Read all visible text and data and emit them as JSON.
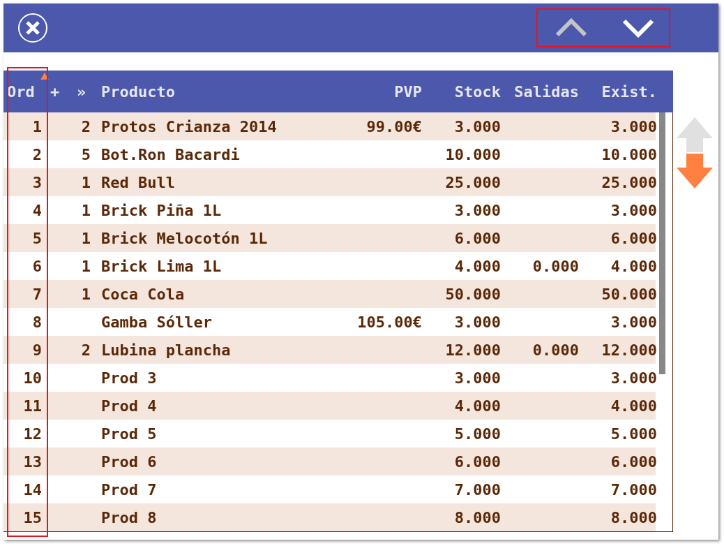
{
  "toolbar": {
    "nav_buttons": [
      {
        "kind": "up",
        "disabled": true
      },
      {
        "kind": "down",
        "disabled": false
      }
    ]
  },
  "table": {
    "columns": [
      {
        "label": "Ord",
        "sorted": true
      },
      {
        "label": "+",
        "sorted": false
      },
      {
        "label": "»",
        "sorted": false
      },
      {
        "label": "Producto",
        "sorted": false
      },
      {
        "label": "PVP",
        "sorted": false
      },
      {
        "label": "Stock",
        "sorted": false
      },
      {
        "label": "Salidas",
        "sorted": false
      },
      {
        "label": "Exist.",
        "sorted": false
      }
    ],
    "rows": [
      {
        "ord": "1",
        "qty": "2",
        "product": "Protos Crianza 2014",
        "pvp": "99.00€",
        "stock": "3.000",
        "exist": "3.000"
      },
      {
        "ord": "2",
        "qty": "5",
        "product": "Bot.Ron Bacardi",
        "stock": "10.000",
        "exist": "10.000"
      },
      {
        "ord": "3",
        "qty": "1",
        "product": "Red Bull",
        "stock": "25.000",
        "exist": "25.000"
      },
      {
        "ord": "4",
        "qty": "1",
        "product": "Brick Piña 1L",
        "stock": "3.000",
        "exist": "3.000"
      },
      {
        "ord": "5",
        "qty": "1",
        "product": "Brick Melocotón 1L",
        "stock": "6.000",
        "exist": "6.000"
      },
      {
        "ord": "6",
        "qty": "1",
        "product": "Brick Lima 1L",
        "stock": "4.000",
        "salidas": "0.000",
        "exist": "4.000"
      },
      {
        "ord": "7",
        "qty": "1",
        "product": "Coca Cola",
        "stock": "50.000",
        "exist": "50.000"
      },
      {
        "ord": "8",
        "product": "Gamba Sóller",
        "pvp": "105.00€",
        "stock": "3.000",
        "exist": "3.000"
      },
      {
        "ord": "9",
        "qty": "2",
        "product": "Lubina plancha",
        "stock": "12.000",
        "salidas": "0.000",
        "exist": "12.000"
      },
      {
        "ord": "10",
        "product": "Prod 3",
        "stock": "3.000",
        "exist": "3.000"
      },
      {
        "ord": "11",
        "product": "Prod 4",
        "stock": "4.000",
        "exist": "4.000"
      },
      {
        "ord": "12",
        "product": "Prod 5",
        "stock": "5.000",
        "exist": "5.000"
      },
      {
        "ord": "13",
        "product": "Prod 6",
        "stock": "6.000",
        "exist": "6.000"
      },
      {
        "ord": "14",
        "product": "Prod 7",
        "stock": "7.000",
        "exist": "7.000"
      },
      {
        "ord": "15",
        "product": "Prod 8",
        "stock": "8.000",
        "exist": "8.000"
      }
    ]
  },
  "scroll_buttons": [
    {
      "kind": "up",
      "disabled": true
    },
    {
      "kind": "down",
      "disabled": false
    }
  ]
}
